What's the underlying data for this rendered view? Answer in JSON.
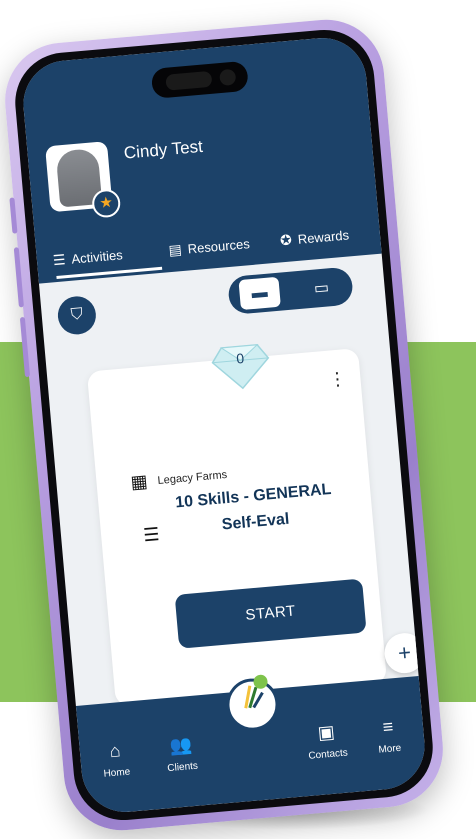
{
  "profile": {
    "name": "Cindy Test"
  },
  "tabs": [
    {
      "label": "Activities",
      "icon": "sliders-icon"
    },
    {
      "label": "Resources",
      "icon": "clipboard-icon"
    },
    {
      "label": "Rewards",
      "icon": "award-icon"
    }
  ],
  "card": {
    "gem_count": "0",
    "org_name": "Legacy Farms",
    "title_line1": "10 Skills - GENERAL",
    "title_line2": "Self-Eval",
    "start_label": "START"
  },
  "fab": {
    "label": "+"
  },
  "bottom_nav": [
    {
      "label": "Home",
      "icon": "home-icon"
    },
    {
      "label": "Clients",
      "icon": "users-icon"
    },
    {
      "label": "Contacts",
      "icon": "chat-icon"
    },
    {
      "label": "More",
      "icon": "menu-icon"
    }
  ],
  "colors": {
    "primary": "#1c4269",
    "accent_green": "#8dc45c",
    "phone_purple": "#b79ee0"
  }
}
